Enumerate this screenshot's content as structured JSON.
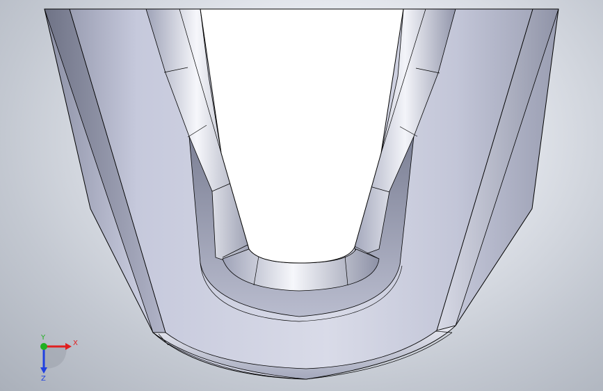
{
  "triad": {
    "x_label": "X",
    "y_label": "Y",
    "z_label": "Z",
    "x_color": "#e02020",
    "y_color": "#20b020",
    "z_color": "#2040e0"
  },
  "model": {
    "body_color": "#c5c9db",
    "highlight_color": "#f4f5fa",
    "shadow_color": "#7d8196",
    "edge_color": "#000000",
    "opening_color": "#ffffff"
  }
}
